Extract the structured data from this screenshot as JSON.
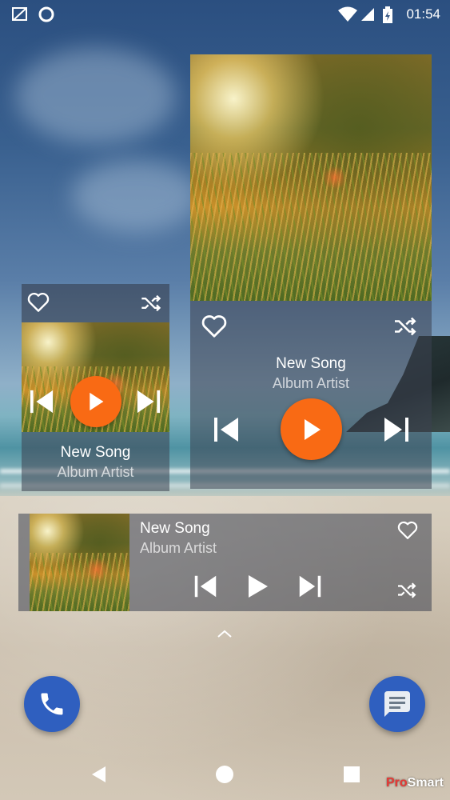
{
  "status_bar": {
    "time": "01:54"
  },
  "widget_large": {
    "song": "New Song",
    "artist": "Album Artist"
  },
  "widget_small": {
    "song": "New Song",
    "artist": "Album Artist"
  },
  "widget_wide": {
    "song": "New Song",
    "artist": "Album Artist"
  },
  "dock": {
    "phone_icon": "phone-icon",
    "messages_icon": "messages-icon"
  },
  "nav": {
    "back": "back-icon",
    "home": "home-icon",
    "recents": "recents-icon"
  },
  "watermark": {
    "brand_prefix": "Pro",
    "brand_suffix": "Smart"
  },
  "colors": {
    "accent": "#f96a14",
    "fab_blue": "#2f5fbf"
  }
}
